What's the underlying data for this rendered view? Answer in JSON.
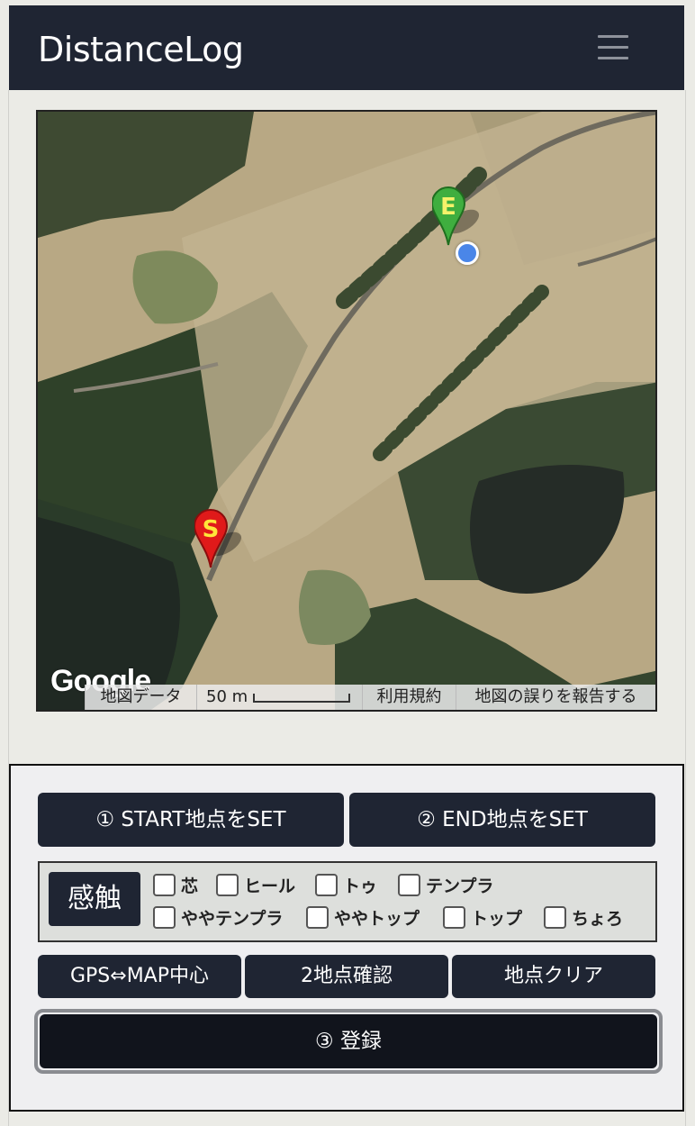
{
  "navbar": {
    "brand": "DistanceLog",
    "menu_icon": "hamburger-icon"
  },
  "map": {
    "start_marker": "S",
    "end_marker": "E",
    "google_logo": "Google",
    "attribution": {
      "map_data": "地図データ",
      "scale_label": "50 m",
      "terms": "利用規約",
      "report_error": "地図の誤りを報告する"
    },
    "colors": {
      "start_pin": "#e01a1a",
      "end_pin": "#3fae3f",
      "gps_dot": "#4a86e8"
    }
  },
  "controls": {
    "set_start": "① START地点をSET",
    "set_end": "② END地点をSET",
    "touch_label": "感触",
    "touch_options": [
      "芯",
      "ヒール",
      "トゥ",
      "テンプラ",
      "ややテンプラ",
      "ややトップ",
      "トップ",
      "ちょろ"
    ],
    "gps_center": "GPS⇔MAP中心",
    "confirm_points": "2地点確認",
    "clear_points": "地点クリア",
    "register": "③ 登録"
  },
  "colors": {
    "navbar": "#1f2533",
    "button": "#1f2533",
    "register": "#11141c"
  }
}
